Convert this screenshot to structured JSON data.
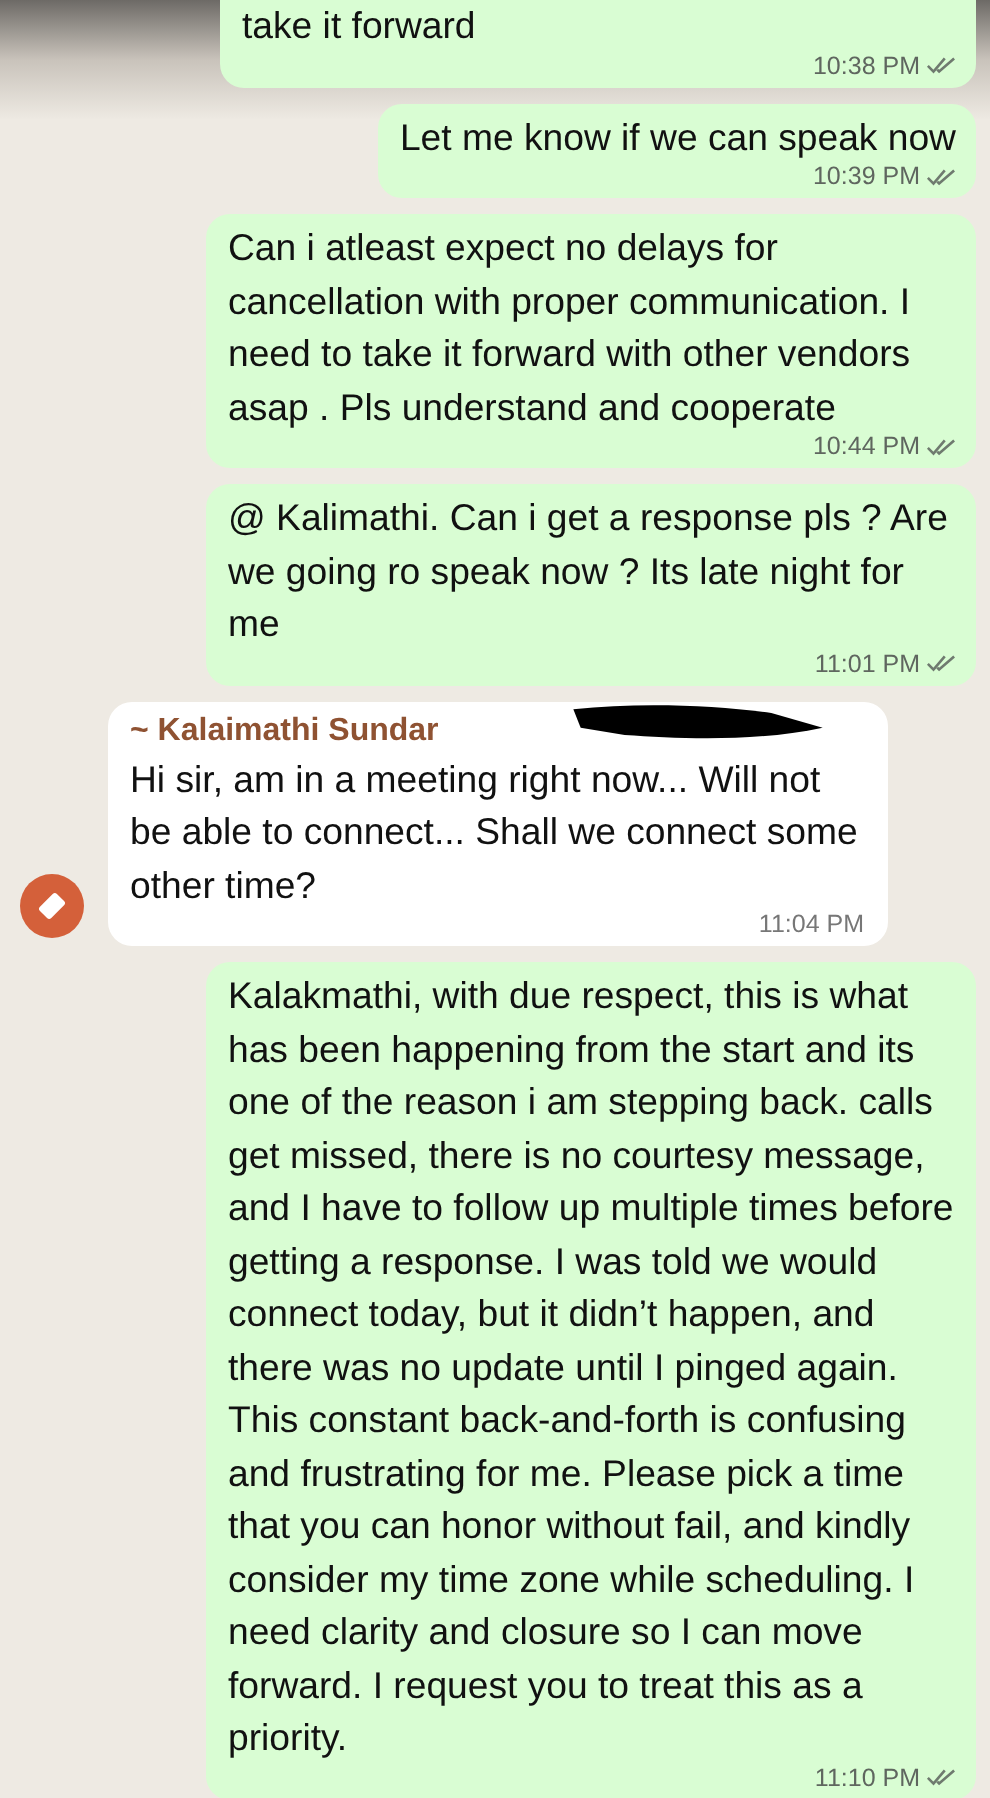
{
  "messages": [
    {
      "kind": "outgoing",
      "text": "take it forward",
      "time": "10:38 PM",
      "cut_top": true
    },
    {
      "kind": "outgoing",
      "text": "Let me know if we can speak now",
      "time": "10:39 PM",
      "cut_top": false
    },
    {
      "kind": "outgoing",
      "text": "Can i atleast expect no delays for cancellation with proper communication. I need to take it forward with other vendors asap . Pls understand and cooperate",
      "time": "10:44 PM",
      "cut_top": false
    },
    {
      "kind": "outgoing",
      "text": "@ Kalimathi. Can i get a response pls ? Are we going ro speak now ? Its late night for me",
      "time": "11:01 PM",
      "cut_top": false
    },
    {
      "kind": "incoming",
      "sender": "~ Kalaimathi Sundar",
      "redacted": true,
      "text": "Hi sir, am in a meeting right now... Will not be able to connect... Shall we connect some other time?",
      "time": "11:04 PM",
      "cut_top": false
    },
    {
      "kind": "outgoing",
      "text": "Kalakmathi, with due respect, this is what has been happening from the start and its one of the reason i am stepping back. calls get missed, there is no courtesy message, and I have to follow up multiple times before getting a response. I was told we would connect today, but it didn’t happen, and there was no update until I pinged again. This constant back-and-forth is confusing and frustrating for me. Please pick a time that you can honor without fail, and kindly consider my time zone while scheduling. I need clarity and closure so I can move forward. I request you to treat this as a priority.",
      "time": "11:10 PM",
      "cut_top": false
    }
  ]
}
